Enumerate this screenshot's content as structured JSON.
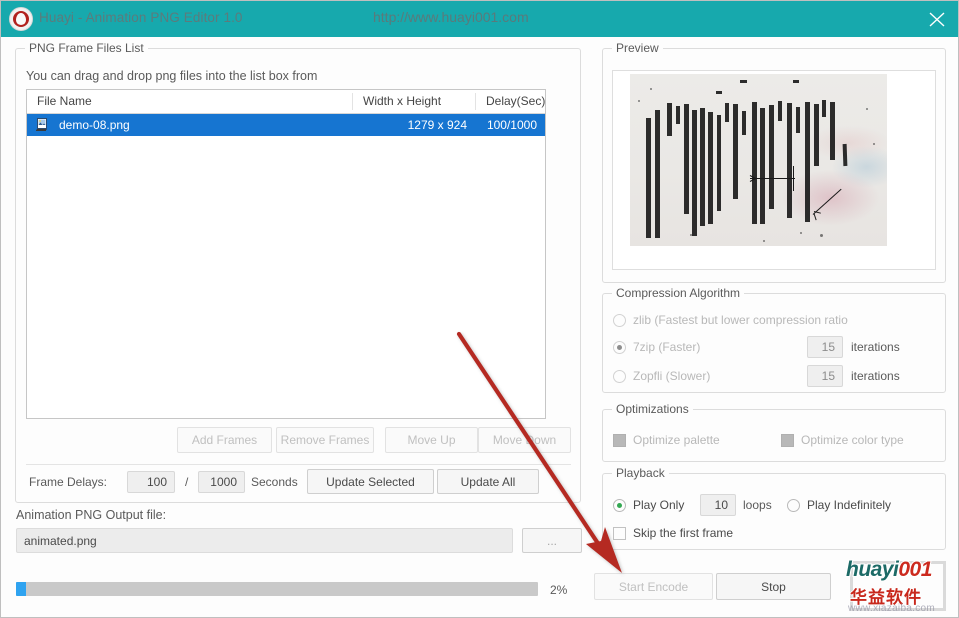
{
  "window": {
    "title": "Huayi - Animation PNG Editor 1.0",
    "url": "http://www.huayi001.com",
    "titlebar_color": "#17a9ad",
    "close_label": "close-icon"
  },
  "frame_list": {
    "group_title": "PNG Frame Files List",
    "hint": "You can drag and drop png files into the list box from",
    "columns": [
      "File Name",
      "Width x Height",
      "Delay(Sec)"
    ],
    "rows": [
      {
        "name": "demo-08.png",
        "size": "1279 x 924",
        "delay": "100/1000",
        "selected": true
      }
    ],
    "buttons": [
      {
        "label": "Add Frames",
        "enabled": false
      },
      {
        "label": "Remove Frames",
        "enabled": false
      },
      {
        "label": "Move Up",
        "enabled": false
      },
      {
        "label": "Move Down",
        "enabled": false
      }
    ],
    "delays": {
      "label": "Frame Delays:",
      "numerator": "100",
      "separator": "/",
      "denominator": "1000",
      "unit": "Seconds",
      "update_selected": "Update Selected",
      "update_all": "Update All"
    }
  },
  "output": {
    "label": "Animation PNG Output file:",
    "filename": "animated.png",
    "browse_label": "..."
  },
  "progress": {
    "percent_text": "2%",
    "percent_value": 2,
    "fill_color": "#2fa3f0"
  },
  "preview": {
    "group_title": "Preview"
  },
  "compression": {
    "group_title": "Compression Algorithm",
    "options": [
      {
        "label": "zlib (Fastest but lower compression ratio",
        "selected": false,
        "disabled": true,
        "iterations": null
      },
      {
        "label": "7zip (Faster)",
        "selected": true,
        "disabled": true,
        "iterations": "15",
        "iterations_label": "iterations"
      },
      {
        "label": "Zopfli (Slower)",
        "selected": false,
        "disabled": true,
        "iterations": "15",
        "iterations_label": "iterations"
      }
    ]
  },
  "optimizations": {
    "group_title": "Optimizations",
    "items": [
      {
        "label": "Optimize palette",
        "checked": true,
        "disabled": true
      },
      {
        "label": "Optimize color type",
        "checked": true,
        "disabled": true
      }
    ]
  },
  "playback": {
    "group_title": "Playback",
    "play_only_label": "Play Only",
    "loops_value": "10",
    "loops_label": "loops",
    "play_indefinitely_label": "Play Indefinitely",
    "skip_first_frame_label": "Skip the first frame",
    "play_only_selected": true,
    "play_indefinitely_selected": false,
    "skip_first_frame_checked": false
  },
  "actions": {
    "start_encode": "Start Encode",
    "start_encode_enabled": false,
    "stop": "Stop",
    "stop_enabled": true
  },
  "watermark": {
    "brand_main": "huayi",
    "brand_num": "001",
    "brand_cn": "华益软件",
    "site": "www.xiazaiba.com"
  },
  "annotation": {
    "arrow_color": "#b52a22"
  }
}
